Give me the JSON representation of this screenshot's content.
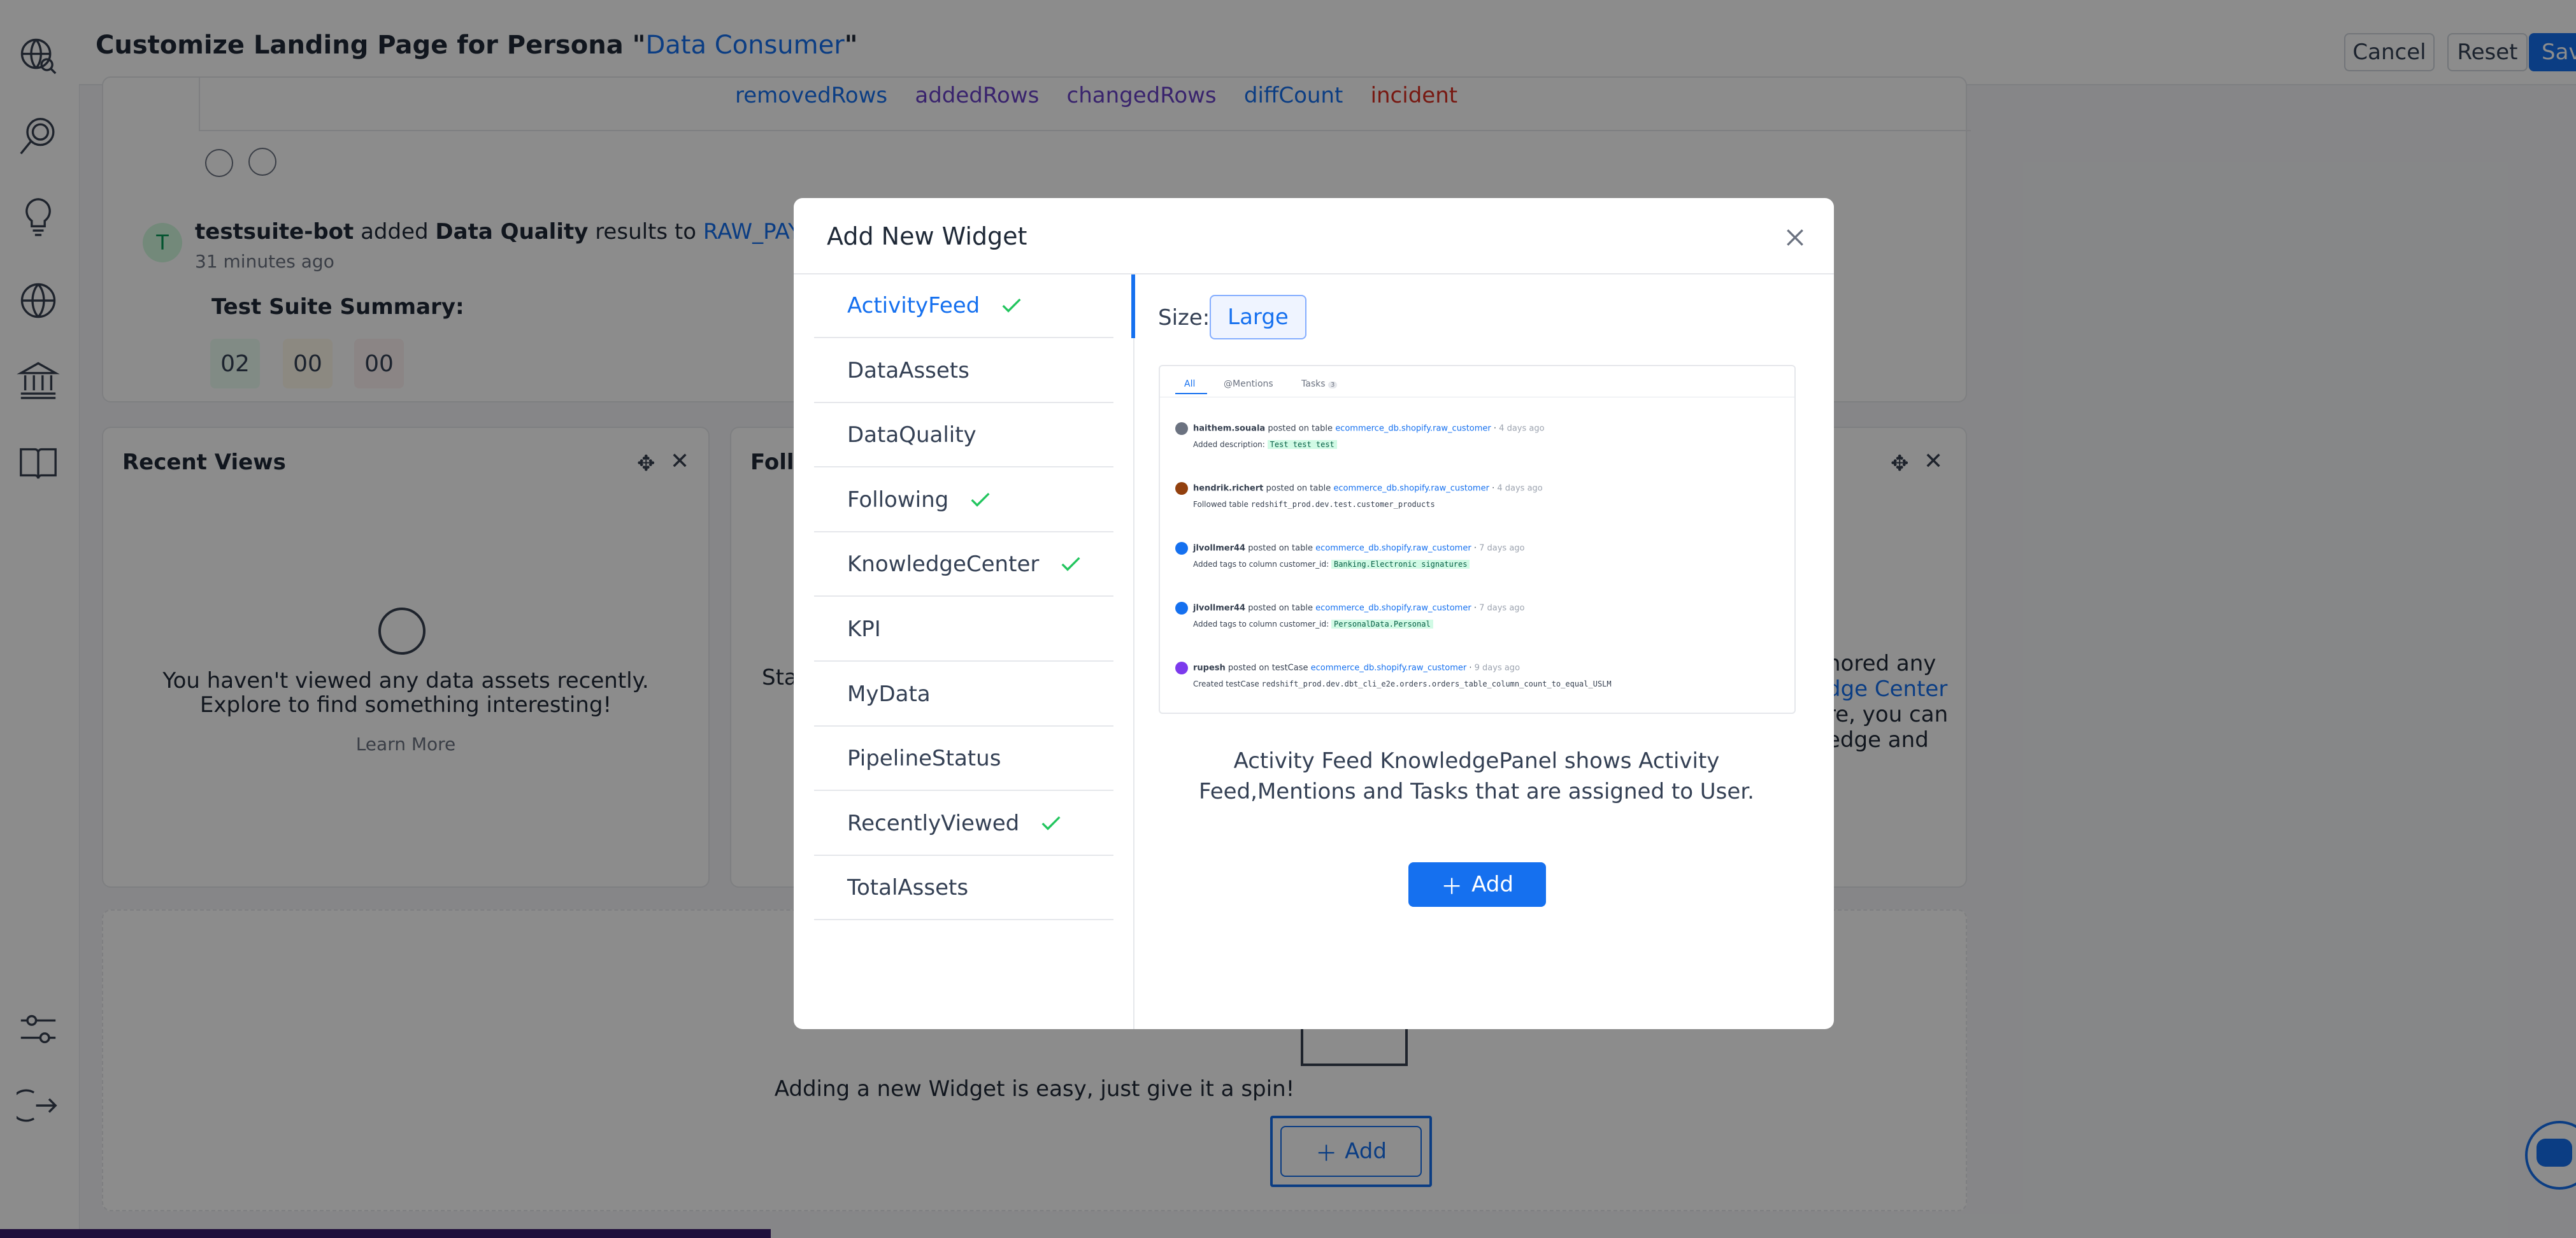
{
  "header": {
    "title_prefix": "Customize Landing Page for Persona \"",
    "persona": "Data Consumer",
    "title_suffix": "\"",
    "cancel_label": "Cancel",
    "reset_label": "Reset",
    "save_label": "Sav"
  },
  "sidebar": {
    "icons": [
      "explore-icon",
      "search-insight-icon",
      "bulb-icon",
      "globe-icon",
      "governance-icon",
      "glossary-book-icon",
      "settings-sliders-icon",
      "logout-icon"
    ]
  },
  "feed": {
    "tags": [
      "removedRows",
      "addedRows",
      "changedRows",
      "diffCount",
      "incident"
    ],
    "author_initial": "T",
    "author": "testsuite-bot",
    "action_text": "added",
    "action_bold": "Data Quality",
    "action_text2": "results to",
    "target": "RAW_PAYMEN",
    "time": "31 minutes ago",
    "summary_title": "Test Suite Summary:",
    "summary_values": [
      "02",
      "00",
      "00"
    ]
  },
  "recent_views": {
    "title": "Recent Views",
    "empty_text": "You haven't viewed any data assets recently. Explore to find something interesting!",
    "learn_more": "Learn More"
  },
  "following_partial": {
    "title": "Follo",
    "text": "Sta"
  },
  "knowledge_partial": {
    "line1": "nored any",
    "line2": "dge Center",
    "line3": "re, you can",
    "line4": "edge and"
  },
  "add_widget_area": {
    "text": "Adding a new Widget is easy, just give it a spin!",
    "add_label": "Add"
  },
  "modal": {
    "title": "Add New Widget",
    "widgets": [
      {
        "label": "ActivityFeed",
        "added": true,
        "active": true
      },
      {
        "label": "DataAssets",
        "added": false
      },
      {
        "label": "DataQuality",
        "added": false
      },
      {
        "label": "Following",
        "added": true
      },
      {
        "label": "KnowledgeCenter",
        "added": true
      },
      {
        "label": "KPI",
        "added": false
      },
      {
        "label": "MyData",
        "added": false
      },
      {
        "label": "PipelineStatus",
        "added": false
      },
      {
        "label": "RecentlyViewed",
        "added": true
      },
      {
        "label": "TotalAssets",
        "added": false
      }
    ],
    "size_label": "Size:",
    "size_value": "Large",
    "description": "Activity Feed KnowledgePanel shows Activity Feed,Mentions and Tasks that are assigned to User.",
    "add_label": "Add",
    "preview": {
      "tabs": [
        "All",
        "@Mentions",
        "Tasks"
      ],
      "tasks_count": "3",
      "rows": [
        {
          "user": "haithem.souala",
          "action": "posted on table",
          "target": "ecommerce_db.shopify.raw_customer",
          "time": "4 days ago",
          "detail": "Added description:",
          "value": "Test test test"
        },
        {
          "user": "hendrik.richert",
          "action": "posted on table",
          "target": "ecommerce_db.shopify.raw_customer",
          "time": "4 days ago",
          "detail": "Followed table",
          "value": "redshift_prod.dev.test.customer_products"
        },
        {
          "user": "jlvollmer44",
          "action": "posted on table",
          "target": "ecommerce_db.shopify.raw_customer",
          "time": "7 days ago",
          "detail": "Added tags to column customer_id:",
          "value": "Banking.Electronic signatures"
        },
        {
          "user": "jlvollmer44",
          "action": "posted on table",
          "target": "ecommerce_db.shopify.raw_customer",
          "time": "7 days ago",
          "detail": "Added tags to column customer_id:",
          "value": "PersonalData.Personal"
        },
        {
          "user": "rupesh",
          "action": "posted on testCase",
          "target": "ecommerce_db.shopify.raw_customer",
          "time": "9 days ago",
          "detail": "Created testCase",
          "value": "redshift_prod.dev.dbt_cli_e2e.orders.orders_table_column_count_to_equal_USLM"
        }
      ]
    }
  },
  "colors": {
    "accent": "#1570ef",
    "check": "#22c55e",
    "overlay": "rgba(0,0,0,0.45)"
  }
}
